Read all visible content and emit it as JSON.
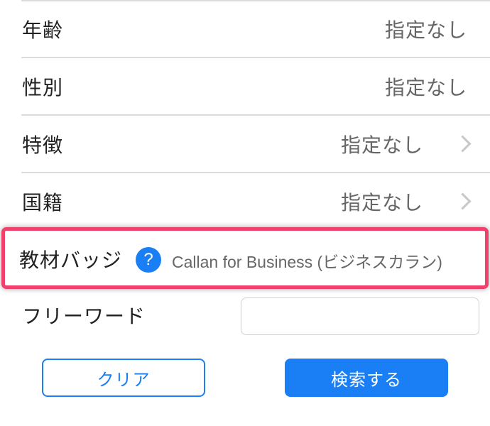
{
  "filters": [
    {
      "label": "年齢",
      "value": "指定なし",
      "has_chevron": false
    },
    {
      "label": "性別",
      "value": "指定なし",
      "has_chevron": false
    },
    {
      "label": "特徴",
      "value": "指定なし",
      "has_chevron": true
    },
    {
      "label": "国籍",
      "value": "指定なし",
      "has_chevron": true
    }
  ],
  "badge": {
    "label": "教材バッジ",
    "help_symbol": "?",
    "value": "Callan for Business (ビジネスカラン)"
  },
  "freeword": {
    "label": "フリーワード",
    "value": "",
    "placeholder": ""
  },
  "actions": {
    "clear_label": "クリア",
    "search_label": "検索する"
  },
  "colors": {
    "accent": "#1a7ff5",
    "highlight_border": "#f0406c",
    "divider": "#dcdcdc",
    "chevron": "#c7c7cc"
  }
}
